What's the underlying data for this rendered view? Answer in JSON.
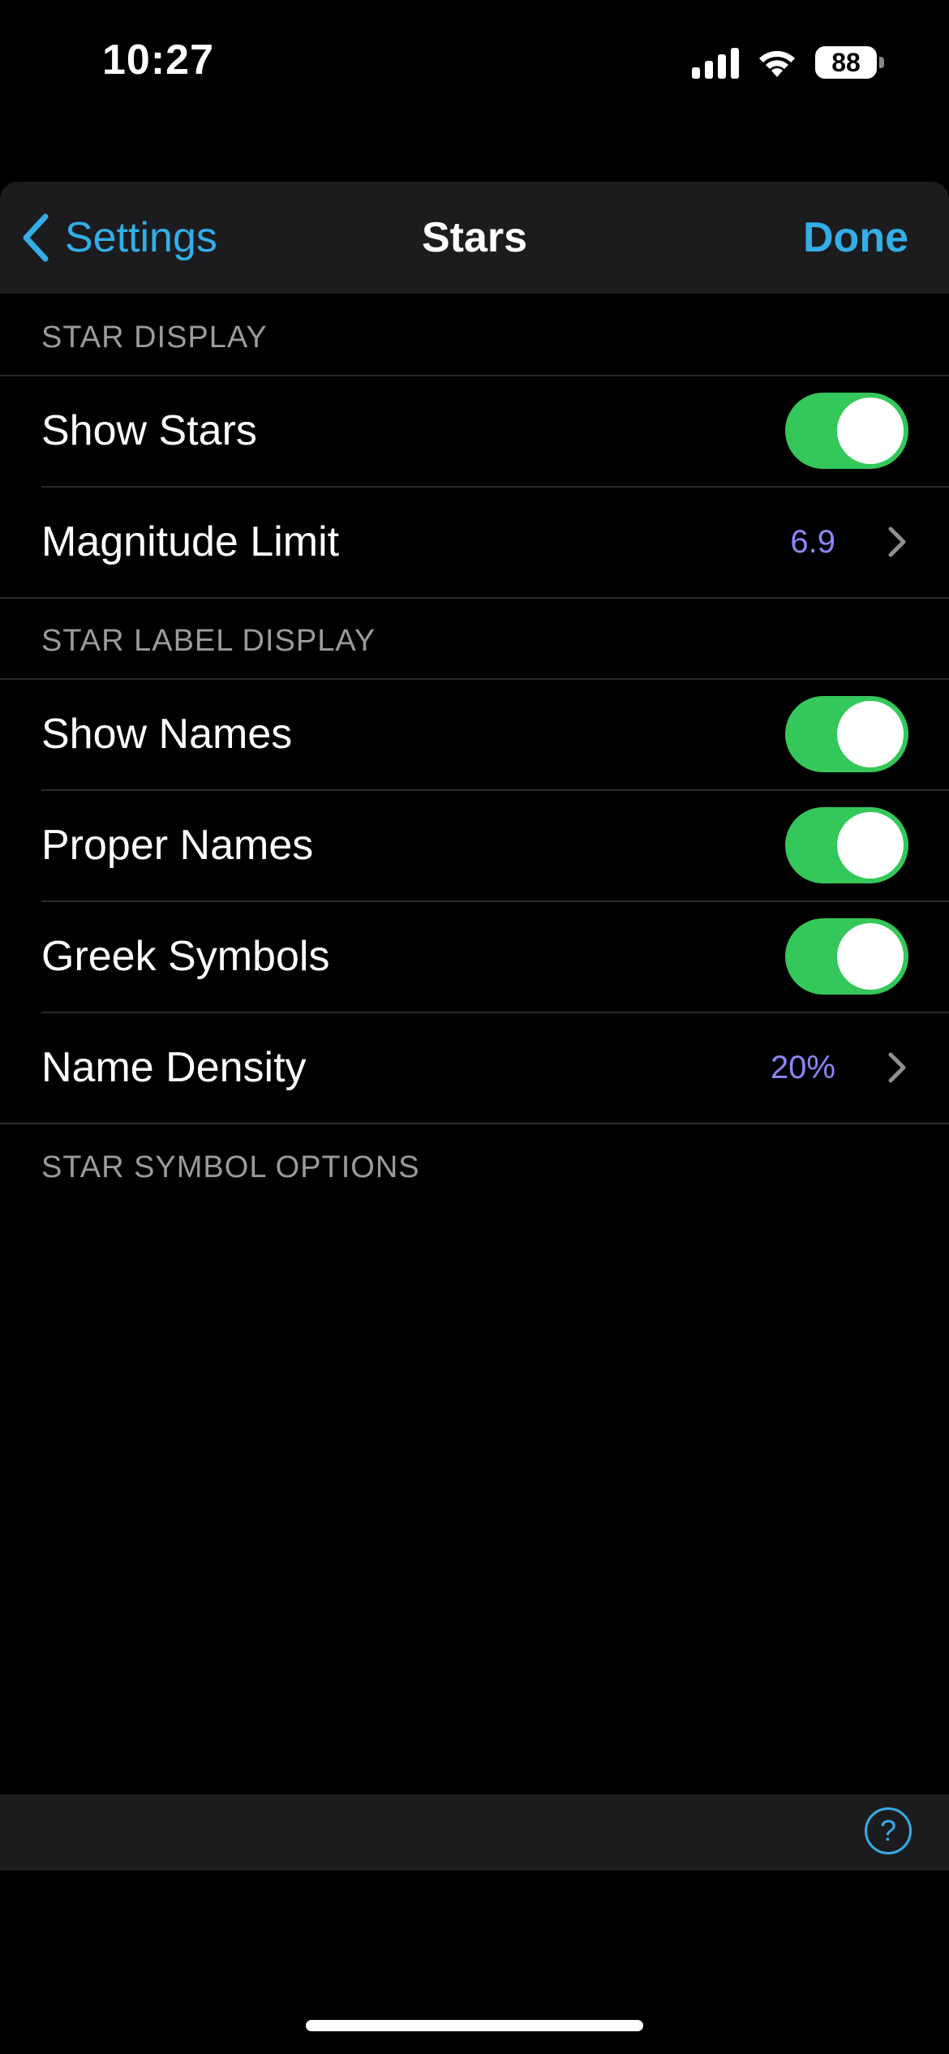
{
  "status_bar": {
    "time": "10:27",
    "battery_level": "88"
  },
  "nav": {
    "back_label": "Settings",
    "title": "Stars",
    "done_label": "Done"
  },
  "sections": {
    "star_display": {
      "header": "STAR DISPLAY",
      "show_stars": {
        "label": "Show Stars",
        "on": true
      },
      "magnitude_limit": {
        "label": "Magnitude Limit",
        "value": "6.9"
      }
    },
    "star_label_display": {
      "header": "STAR LABEL DISPLAY",
      "show_names": {
        "label": "Show Names",
        "on": true
      },
      "proper_names": {
        "label": "Proper Names",
        "on": true
      },
      "greek_symbols": {
        "label": "Greek Symbols",
        "on": true
      },
      "name_density": {
        "label": "Name Density",
        "value": "20%"
      }
    },
    "star_symbol_options": {
      "header": "STAR SYMBOL OPTIONS"
    }
  },
  "toolbar": {
    "help_label": "?"
  },
  "colors": {
    "accent": "#33aee8",
    "toggle_on": "#34c759",
    "value_text": "#8c86f5",
    "background": "#000000",
    "bar_background": "#1c1c1e"
  }
}
